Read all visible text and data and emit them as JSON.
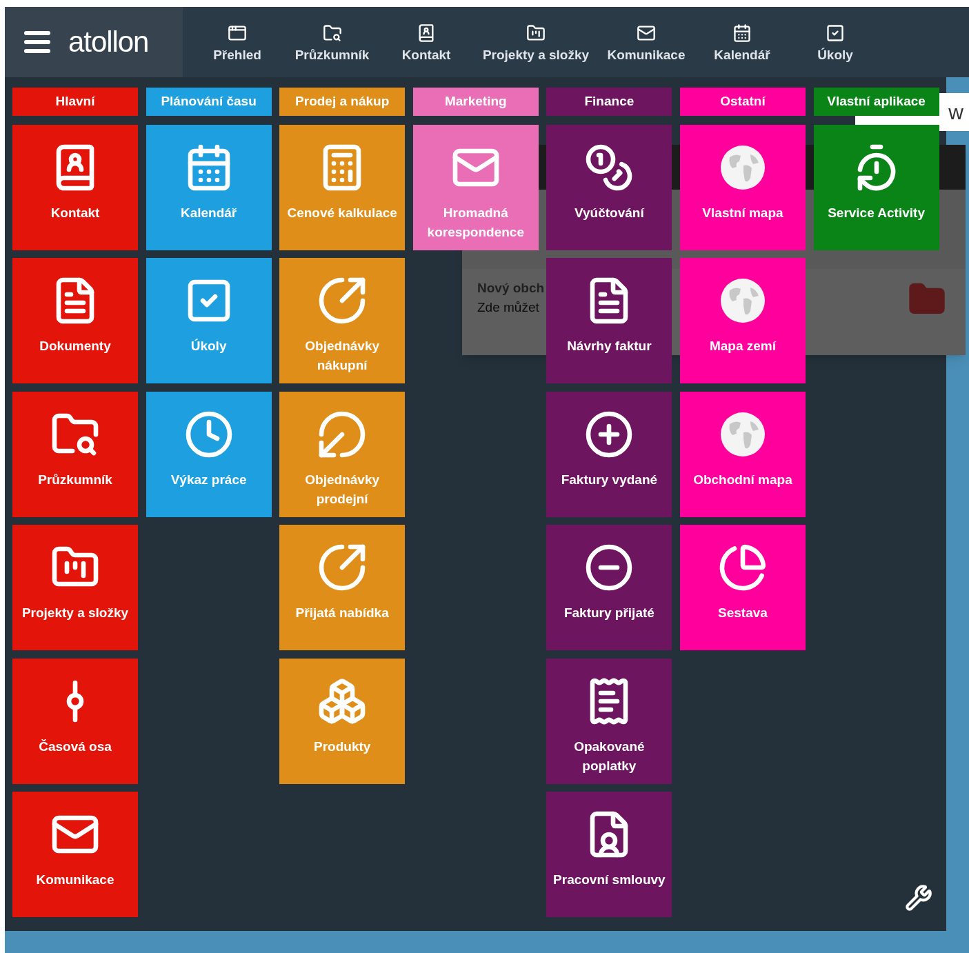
{
  "top_bar": {
    "logo": "atollon",
    "nav": [
      {
        "label": "Přehled"
      },
      {
        "label": "Průzkumník"
      },
      {
        "label": "Kontakt"
      },
      {
        "label": "Projekty a složky"
      },
      {
        "label": "Komunikace"
      },
      {
        "label": "Kalendář"
      },
      {
        "label": "Úkoly"
      }
    ]
  },
  "background_page": {
    "field_text": "w",
    "item_title": "Nový obch",
    "item_text": "Zde můžet"
  },
  "columns": [
    {
      "title": "Hlavní",
      "color": "#e3150b",
      "tiles": [
        "Kontakt",
        "Dokumenty",
        "Průzkumník",
        "Projekty a složky",
        "Časová osa",
        "Komunikace"
      ]
    },
    {
      "title": "Plánování času",
      "color": "#1e9fe0",
      "tiles": [
        "Kalendář",
        "Úkoly",
        "Výkaz práce"
      ]
    },
    {
      "title": "Prodej a nákup",
      "color": "#df8f19",
      "tiles": [
        "Cenové kalkulace",
        "Objednávky nákupní",
        "Objednávky prodejní",
        "Přijatá nabídka",
        "Produkty"
      ]
    },
    {
      "title": "Marketing",
      "color": "#e96eb6",
      "tiles": [
        "Hromadná korespondence"
      ]
    },
    {
      "title": "Finance",
      "color": "#6e1560",
      "tiles": [
        "Vyúčtování",
        "Návrhy faktur",
        "Faktury vydané",
        "Faktury přijaté",
        "Opakované poplatky",
        "Pracovní smlouvy"
      ]
    },
    {
      "title": "Ostatní",
      "color": "#ff009c",
      "tiles": [
        "Vlastní mapa",
        "Mapa zemí",
        "Obchodní mapa",
        "Sestava"
      ]
    },
    {
      "title": "Vlastní aplikace",
      "color": "#0a8416",
      "tiles": [
        "Service Activity"
      ]
    }
  ]
}
